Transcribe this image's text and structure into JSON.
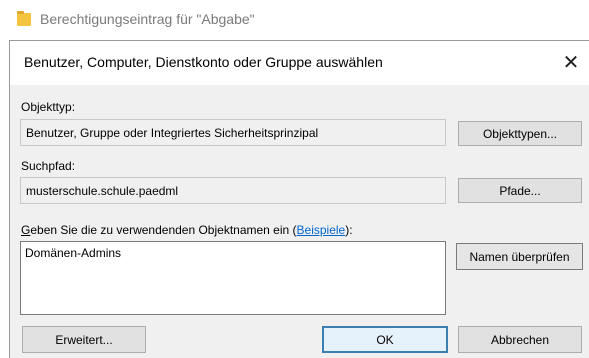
{
  "background_window": {
    "title": "Berechtigungseintrag für \"Abgabe\""
  },
  "dialog": {
    "title": "Benutzer, Computer, Dienstkonto oder Gruppe auswählen",
    "close_glyph": "✕",
    "object_type": {
      "label": "Objekttyp:",
      "value": "Benutzer, Gruppe oder Integriertes Sicherheitsprinzipal",
      "button": "Objekttypen..."
    },
    "search_path": {
      "label": "Suchpfad:",
      "value": "musterschule.schule.paedml",
      "button": "Pfade..."
    },
    "names": {
      "label_accesskey": "G",
      "label_rest": "eben Sie die zu verwendenden Objektnamen ein (",
      "example_link": "Beispiele",
      "label_end": "):",
      "value": "Domänen-Admins",
      "check_button": "Namen überprüfen"
    },
    "buttons": {
      "advanced": "Erweitert...",
      "ok": "OK",
      "cancel": "Abbrechen"
    }
  }
}
